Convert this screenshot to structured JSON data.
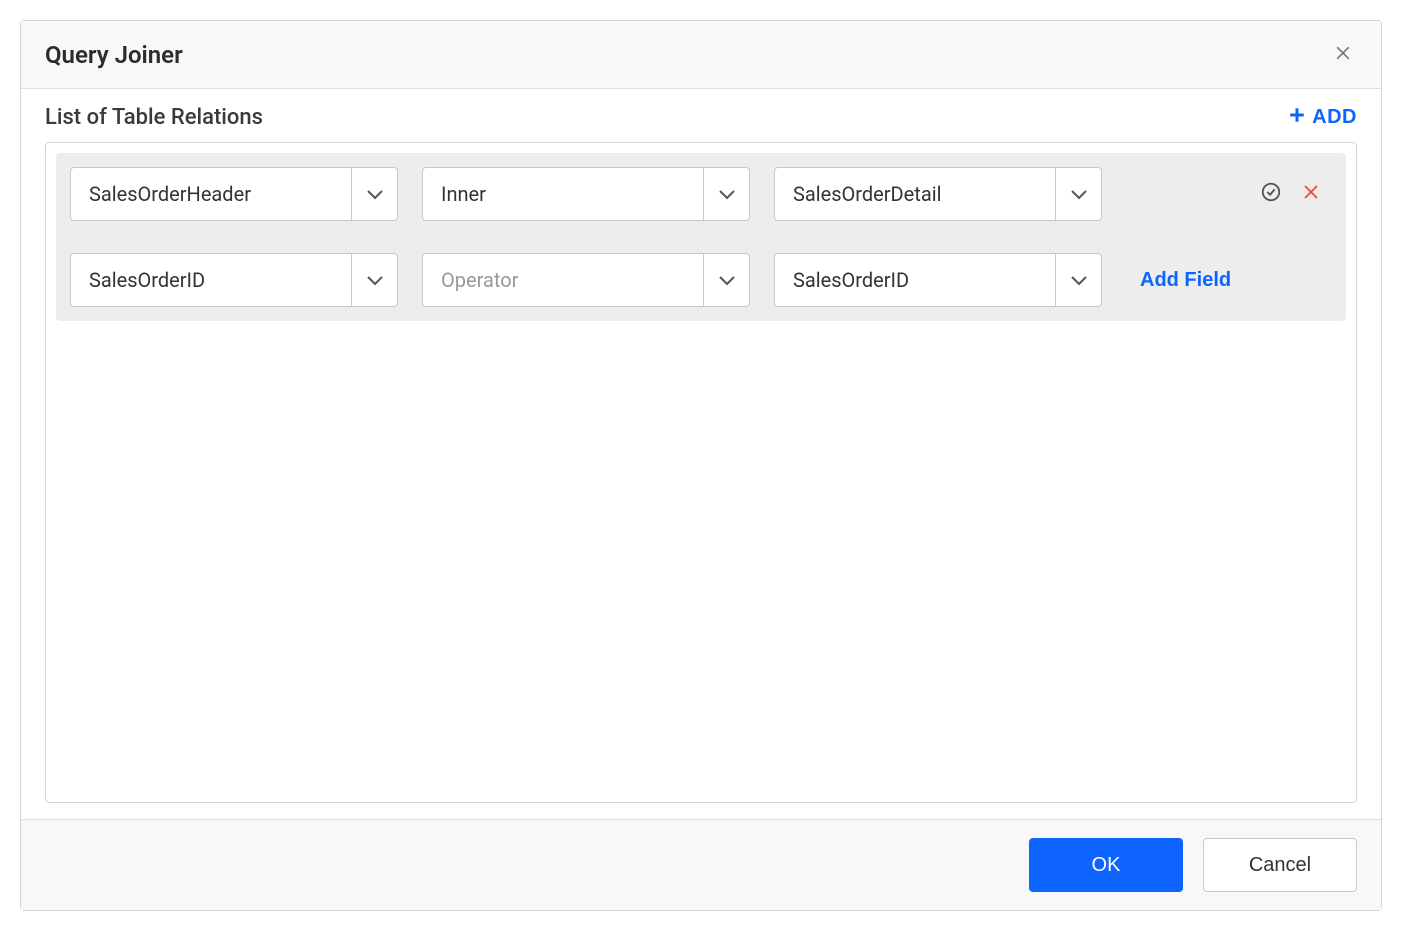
{
  "dialog": {
    "title": "Query Joiner"
  },
  "section": {
    "title": "List of Table Relations",
    "add_label": "ADD"
  },
  "relation": {
    "row1": {
      "left_table": "SalesOrderHeader",
      "join_type": "Inner",
      "right_table": "SalesOrderDetail"
    },
    "row2": {
      "left_field": "SalesOrderID",
      "operator_placeholder": "Operator",
      "right_field": "SalesOrderID",
      "add_field_label": "Add Field"
    }
  },
  "footer": {
    "ok_label": "OK",
    "cancel_label": "Cancel"
  }
}
